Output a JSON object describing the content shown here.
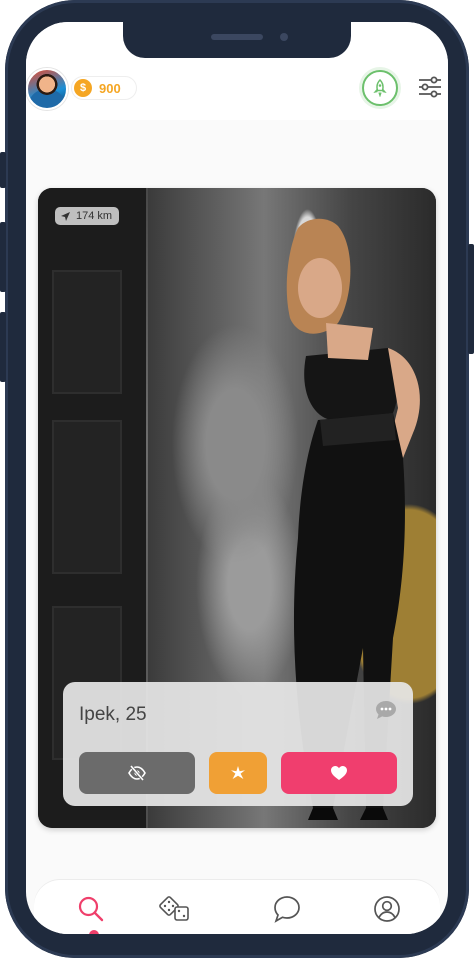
{
  "header": {
    "coins": "900"
  },
  "card": {
    "distance": "174 km",
    "name_age": "Ipek, 25"
  },
  "actions": {
    "hide_icon": "eye-slash-icon",
    "super_icon": "sparkle-icon",
    "like_icon": "heart-icon"
  },
  "nav": {
    "items": [
      "search-icon",
      "dice-icon",
      "chat-icon",
      "profile-icon"
    ],
    "active": "search-icon"
  },
  "colors": {
    "coin": "#f5a623",
    "boost": "#6cc06c",
    "hide": "#6b6b6b",
    "super": "#f0a035",
    "like": "#f03e6e",
    "active_nav": "#ef3f6b"
  }
}
